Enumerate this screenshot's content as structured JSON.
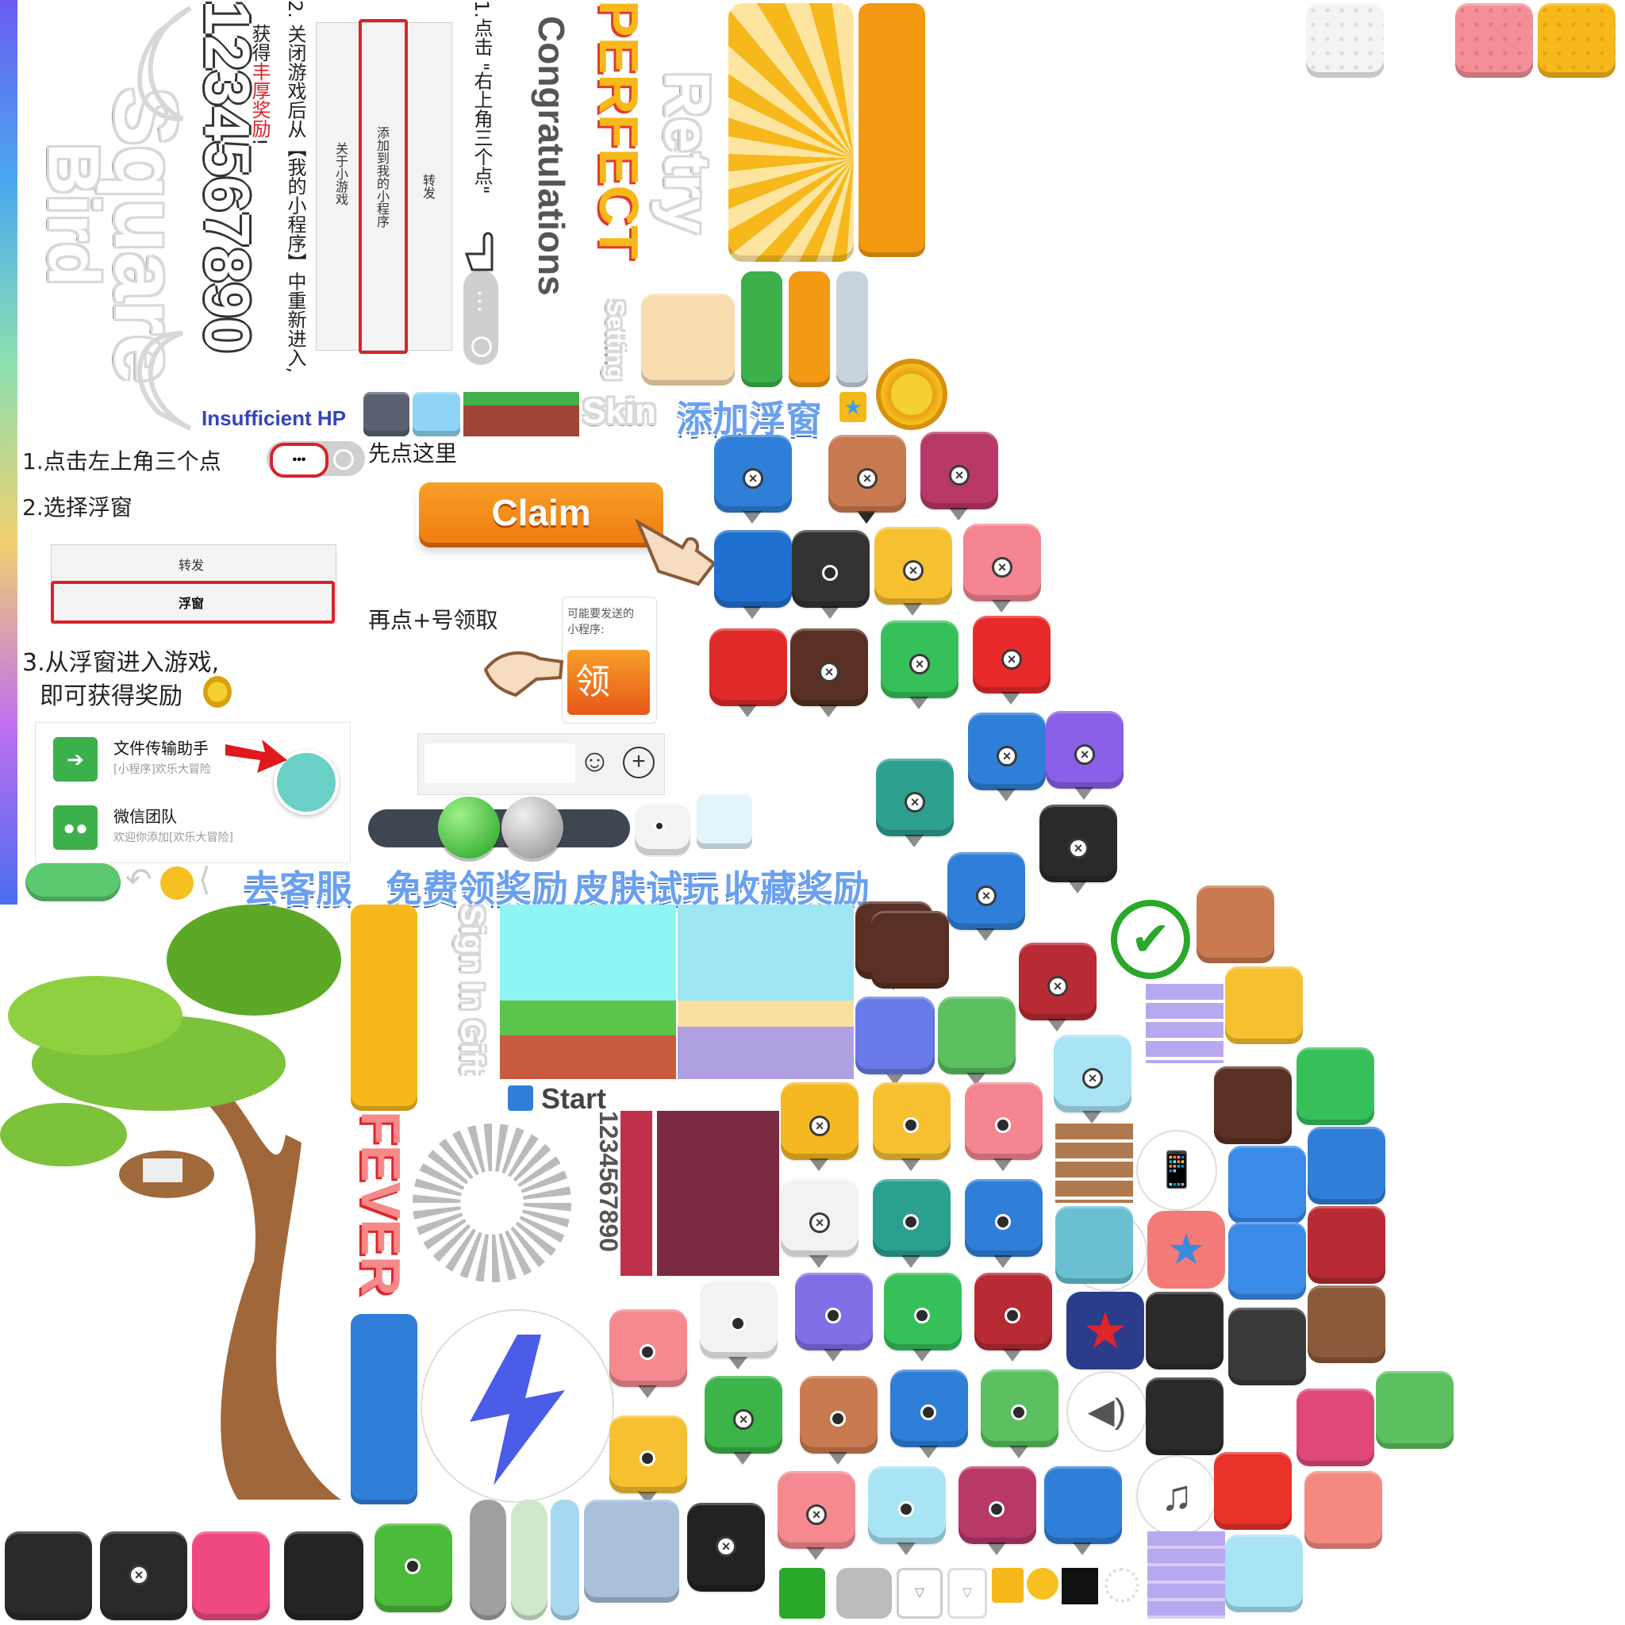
{
  "texts": {
    "square": "Square",
    "bird": "Bird",
    "digits": "1234567890",
    "digits_small": "1234567890",
    "instr_add_step1": "1.点击 \"右上角三个点\"",
    "instr_add_step2_a": "2. 关闭游戏后从【我的小程序】中重新进入,",
    "instr_add_step2_b_prefix": "获得",
    "instr_add_step2_b_highlight": "丰厚奖励",
    "instr_add_step2_b_suffix": "!",
    "menu_forward": "转发",
    "menu_add_my_program": "添加到我的小程序",
    "menu_about": "关于小游戏",
    "congratulations": "Congratulations",
    "perfect": "PERFECT",
    "retry": "Retry",
    "setting": "Setting",
    "skin": "Skin",
    "add_float": "添加浮窗",
    "insufficient_hp": "Insufficient HP",
    "float_step1": "1.点击左上角三个点",
    "float_step2": "2.选择浮窗",
    "float_click_here": "先点这里",
    "menu_forward2": "转发",
    "menu_float": "浮窗",
    "float_step3_a": "3.从浮窗进入游戏,",
    "float_step3_b": "即可获得奖励",
    "claim": "Claim",
    "tap_plus": "再点+号领取",
    "popup_line1": "可能要发送的",
    "popup_line2": "小程序:",
    "popup_button": "领",
    "chat1_name": "文件传输助手",
    "chat1_sub": "[小程序]欢乐大冒险",
    "chat2_name": "微信团队",
    "chat2_sub": "欢迎你添加[欢乐大冒险]",
    "customer_service": "去客服",
    "free_reward": "免费领奖励",
    "skin_trial": "皮肤试玩",
    "collect_reward": "收藏奖励",
    "sign_in_gift": "Sign In Gift",
    "start": "Start",
    "fever": "FEVER",
    "more_button": "•••",
    "plus": "+",
    "smile": "☺",
    "music": "♫",
    "speaker": "🔊",
    "check": "✔",
    "star": "★",
    "x_mark": "×",
    "coin": "●"
  },
  "colors": {
    "orange": "#f39a12",
    "yellow": "#f6b81a",
    "blue_word": "#6aa0f0",
    "claim_orange": "#f07d10",
    "red": "#d8232a",
    "green": "#3cb04a",
    "navy": "#3346b8",
    "grey": "#9a9a9a"
  },
  "icons": [
    "share-icon",
    "back-icon",
    "phone-vibrate-icon",
    "gamepad-icon",
    "star-badge-icon",
    "music-note-icon",
    "speaker-icon",
    "checkmark-icon",
    "lightning-icon",
    "gear-icon",
    "gift-icon",
    "pointing-hand-icon",
    "coin-icon"
  ]
}
